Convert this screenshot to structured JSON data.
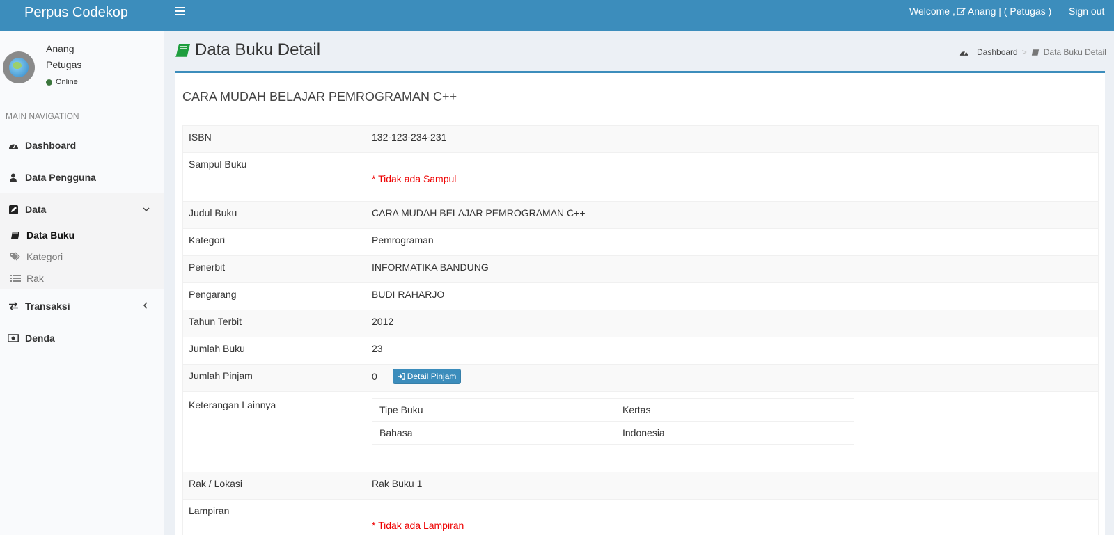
{
  "header": {
    "brand": "Perpus Codekop",
    "welcome_prefix": "Welcome ,",
    "welcome_user": "Anang | ( Petugas )",
    "signout": "Sign out"
  },
  "sidebar": {
    "user_name": "Anang",
    "user_role": "Petugas",
    "status": "Online",
    "nav_header": "MAIN NAVIGATION",
    "items": [
      {
        "label": "Dashboard",
        "icon": "dashboard-icon"
      },
      {
        "label": "Data Pengguna",
        "icon": "user-icon"
      },
      {
        "label": "Data",
        "icon": "edit-icon"
      },
      {
        "label": "Transaksi",
        "icon": "exchange-icon"
      },
      {
        "label": "Denda",
        "icon": "money-icon"
      }
    ],
    "sub_items": [
      {
        "label": "Data Buku",
        "icon": "book-icon"
      },
      {
        "label": "Kategori",
        "icon": "tags-icon"
      },
      {
        "label": "Rak",
        "icon": "list-icon"
      }
    ]
  },
  "page": {
    "title": "Data Buku Detail",
    "breadcrumb": [
      "Dashboard",
      "Data Buku Detail"
    ],
    "breadcrumb_sep": ">"
  },
  "book": {
    "heading": "CARA MUDAH BELAJAR PEMROGRAMAN C++",
    "labels": {
      "isbn": "ISBN",
      "sampul": "Sampul Buku",
      "judul": "Judul Buku",
      "kategori": "Kategori",
      "penerbit": "Penerbit",
      "pengarang": "Pengarang",
      "tahun": "Tahun Terbit",
      "jumlah": "Jumlah Buku",
      "pinjam": "Jumlah Pinjam",
      "keterangan": "Keterangan Lainnya",
      "rak": "Rak / Lokasi",
      "lampiran": "Lampiran"
    },
    "values": {
      "isbn": "132-123-234-231",
      "sampul": "* Tidak ada Sampul",
      "judul": "CARA MUDAH BELAJAR PEMROGRAMAN C++",
      "kategori": "Pemrograman",
      "penerbit": "INFORMATIKA BANDUNG",
      "pengarang": "BUDI RAHARJO",
      "tahun": "2012",
      "jumlah": "23",
      "pinjam": "0",
      "pinjam_button": "Detail Pinjam",
      "rak": "Rak Buku 1",
      "lampiran": "* Tidak ada Lampiran"
    },
    "keterangan": [
      {
        "key": "Tipe Buku",
        "value": "Kertas"
      },
      {
        "key": "Bahasa",
        "value": "Indonesia"
      }
    ]
  }
}
